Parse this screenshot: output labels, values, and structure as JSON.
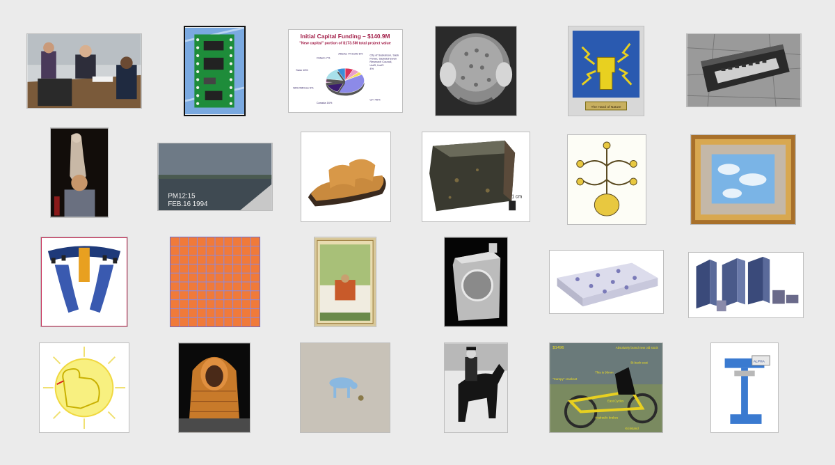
{
  "pie_chart": {
    "title": "Initial Capital Funding – $140.9M",
    "subtitle": "\"New capital\" portion of $173.5M total project value",
    "slices": [
      {
        "label": "Alberta",
        "pct": "7%",
        "value": 7,
        "color": "#d9335a"
      },
      {
        "label": "UofS",
        "pct": "6%",
        "value": 6,
        "color": "#e9a0c8"
      },
      {
        "label": "City of Saskatoon, Sask Power, Saskatchewan Research Council, UofS, UofO",
        "pct": "4%",
        "value": 4,
        "color": "#f2e05a"
      },
      {
        "label": "CFI",
        "pct": "40%",
        "value": 40,
        "color": "#8c8ae8"
      },
      {
        "label": "Canada",
        "pct": "16%",
        "value": 16,
        "color": "#3a1b6e"
      },
      {
        "label": "NRC/NRCan",
        "pct": "5%",
        "value": 5,
        "color": "#c45ab0"
      },
      {
        "label": "Sask",
        "pct": "16%",
        "value": 16,
        "color": "#a8e0ea"
      },
      {
        "label": "Ontario",
        "pct": "7%",
        "value": 7,
        "color": "#3a8fd8"
      }
    ],
    "display_labels": {
      "alberta": "Alberta 7%",
      "uofs": "UofS 6%",
      "city1": "City of Saskatoon, Sask",
      "city2": "Power, Saskatchewan",
      "city3": "Research Council,",
      "city4": "UofS, UofO",
      "city5": "4%",
      "cfi": "CFI 40%",
      "canada": "Canada 16%",
      "nrc": "NRC/NRCan 5%",
      "sask": "Sask 16%",
      "ontario": "Ontario 7%"
    }
  },
  "fist_plaque": {
    "caption": "The Hand of Nature"
  },
  "boat_video": {
    "time": "PM12:15",
    "date": "FEB.16 1994"
  },
  "rock_scale": {
    "label": "1 cm"
  },
  "bike": {
    "price": "$1496",
    "notes": [
      "Absolutely brand new old stock",
      "Bi-back seat",
      "\"Campy\" crankset",
      "This is 90mm",
      "East Cycles",
      "Hydraulic brakes",
      "Kickstand"
    ]
  },
  "stringer": {
    "brand": "ALPHA"
  }
}
